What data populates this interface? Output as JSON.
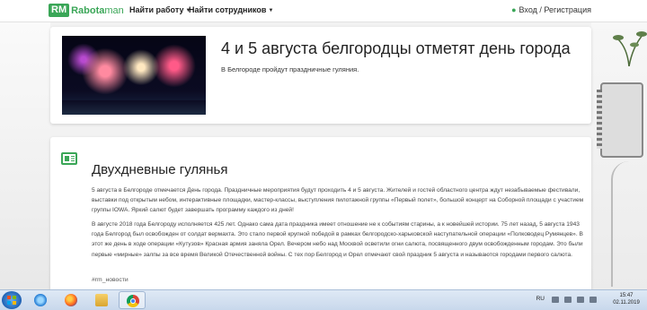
{
  "header": {
    "logo_badge": "RM",
    "logo_rabota": "Rabota",
    "logo_man": "man",
    "nav_find_job": "Найти работу",
    "nav_find_staff": "Найти сотрудников",
    "login": "Вход / Регистрация"
  },
  "hero": {
    "title": "4 и 5 августа белгородцы отметят день города",
    "lead": "В Белгороде пройдут праздничные гуляния."
  },
  "article": {
    "title": "Двухдневные гулянья",
    "paragraph1": "5 августа в Белгороде отмечается День города. Праздничные мероприятия будут проходить 4 и 5 августа. Жителей и гостей областного центра ждут незабываемые фестивали, выставки под открытым небом, интерактивные площадки, мастер-классы, выступления пилотажной группы «Первый полет», большой концерт на Соборной площади с участием группы IOWA.  Яркий салют будет завершать программу каждого из дней!",
    "paragraph2": "В августе 2018 года Белгороду исполняется 425 лет. Однако сама дата праздника имеет отношение не к событиям старины, а к новейшей истории. 75 лет назад, 5 августа 1943 года Белгород был освобожден от солдат вермахта. Это стало первой крупной победой в рамках белгородско-харьковской наступательной операции «Полководец Румянцев».  В этот же день в ходе операции «Кутузов» Красная армия заняла Орел. Вечером небо над Москвой осветили огни салюта, посвященного двум освобожденным городам. Это были первые «мирные» залпы за все время Великой Отечественной войны. С тех пор Белгород и Орел отмечают свой праздник 5 августа и называются городами первого салюта.",
    "tag": "#rm_новости"
  },
  "taskbar": {
    "lang": "RU",
    "time": "15:47",
    "date": "02.11.2019"
  },
  "colors": {
    "brand_green": "#3aa657"
  },
  "icons": [
    "windows-start-icon",
    "ie-icon",
    "firefox-icon",
    "explorer-icon",
    "chrome-icon",
    "user-icon",
    "news-icon"
  ]
}
